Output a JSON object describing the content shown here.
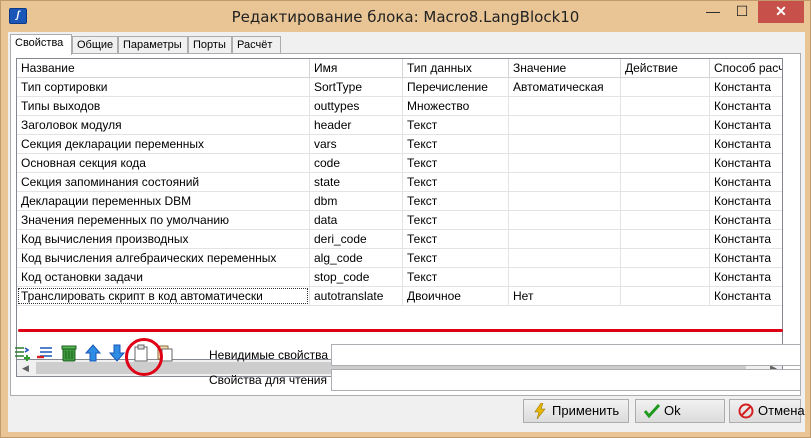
{
  "window": {
    "title": "Редактирование блока: Macro8.LangBlock10",
    "icon_label": "ʃ",
    "controls": {
      "minimize": "—",
      "maximize": "☐",
      "close": "✕"
    }
  },
  "tabs": [
    {
      "label": "Свойства",
      "active": true
    },
    {
      "label": "Общие"
    },
    {
      "label": "Параметры"
    },
    {
      "label": "Порты"
    },
    {
      "label": "Расчёт"
    }
  ],
  "grid": {
    "columns": [
      "Название",
      "Имя",
      "Тип данных",
      "Значение",
      "Действие",
      "Способ расчёта"
    ],
    "rows": [
      [
        "Тип сортировки",
        "SortType",
        "Перечисление",
        "Автоматическая",
        "",
        "Константа"
      ],
      [
        "Типы выходов",
        "outtypes",
        "Множество",
        "",
        "",
        "Константа"
      ],
      [
        "Заголовок модуля",
        "header",
        "Текст",
        "",
        "",
        "Константа"
      ],
      [
        "Секция декларации переменных",
        "vars",
        "Текст",
        "",
        "",
        "Константа"
      ],
      [
        "Основная секция кода",
        "code",
        "Текст",
        "",
        "",
        "Константа"
      ],
      [
        "Секция запоминания состояний",
        "state",
        "Текст",
        "",
        "",
        "Константа"
      ],
      [
        "Декларации переменных DBM",
        "dbm",
        "Текст",
        "",
        "",
        "Константа"
      ],
      [
        "Значения переменных по умолчанию",
        "data",
        "Текст",
        "",
        "",
        "Константа"
      ],
      [
        "Код вычисления производных",
        "deri_code",
        "Текст",
        "",
        "",
        "Константа"
      ],
      [
        "Код вычисления алгебраических переменных",
        "alg_code",
        "Текст",
        "",
        "",
        "Константа"
      ],
      [
        "Код остановки задачи",
        "stop_code",
        "Текст",
        "",
        "",
        "Константа"
      ],
      [
        "Транслировать скрипт в код автоматически",
        "autotranslate",
        "Двоичное",
        "Нет",
        "",
        "Константа"
      ]
    ],
    "selected_row": 11,
    "annotation_color": "#e00016"
  },
  "toolbar": {
    "icons": [
      "add-property-icon",
      "remove-property-icon",
      "delete-icon",
      "move-up-icon",
      "move-down-icon",
      "paste-icon",
      "copy-icon"
    ]
  },
  "properties": {
    "invisible_label": "Невидимые свойства",
    "invisible_value": "",
    "readonly_label": "Свойства для чтения",
    "readonly_value": ""
  },
  "buttons": {
    "apply": "Применить",
    "ok": "Ok",
    "cancel": "Отмена"
  }
}
